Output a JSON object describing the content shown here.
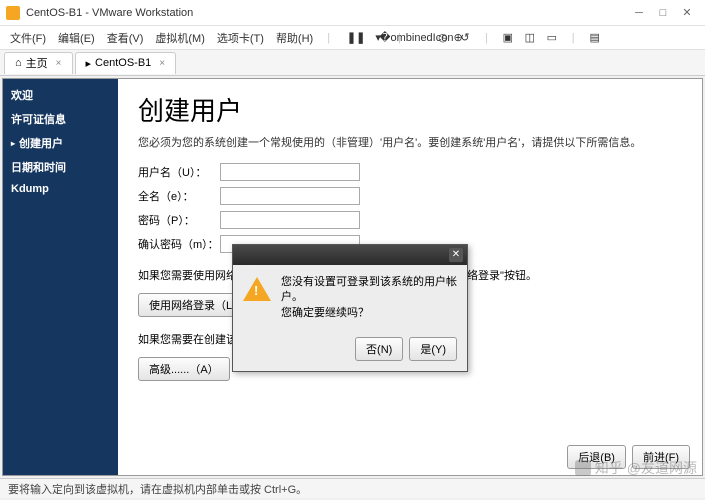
{
  "window": {
    "title": "CentOS-B1 - VMware Workstation"
  },
  "menu": {
    "file": "文件(F)",
    "edit": "编辑(E)",
    "view": "查看(V)",
    "vm": "虚拟机(M)",
    "tabs": "选项卡(T)",
    "help": "帮助(H)"
  },
  "tabs": {
    "home": "主页",
    "vm": "CentOS-B1"
  },
  "sidebar": {
    "items": [
      {
        "label": "欢迎"
      },
      {
        "label": "许可证信息"
      },
      {
        "label": "创建用户",
        "active": true
      },
      {
        "label": "日期和时间"
      },
      {
        "label": "Kdump"
      }
    ]
  },
  "page": {
    "title": "创建用户",
    "desc": "您必须为您的系统创建一个常规使用的（非管理）'用户名'。要创建系统'用户名'，请提供以下所需信息。",
    "username_label": "用户名（U）：",
    "fullname_label": "全名（e）：",
    "password_label": "密码（P）：",
    "confirm_label": "确认密码（m）：",
    "note1": "如果您需要使用网络验证，比如 Kerberos 或者 NIS，请点击\"使用网络登录\"按钮。",
    "net_login_btn": "使用网络登录（L）...",
    "note2": "如果您需要在创建该用户时有更多控制 [ 指钮。",
    "advanced_btn": "高级......（A）",
    "back_btn": "后退(B)",
    "forward_btn": "前进(F)"
  },
  "dialog": {
    "line1": "您没有设置可登录到该系统的用户帐户。",
    "line2": "您确定要继续吗？",
    "no_btn": "否(N)",
    "yes_btn": "是(Y)"
  },
  "status": {
    "text": "要将输入定向到该虚拟机，请在虚拟机内部单击或按 Ctrl+G。"
  },
  "watermark": {
    "brand": "知乎",
    "author": "@友道网源"
  }
}
